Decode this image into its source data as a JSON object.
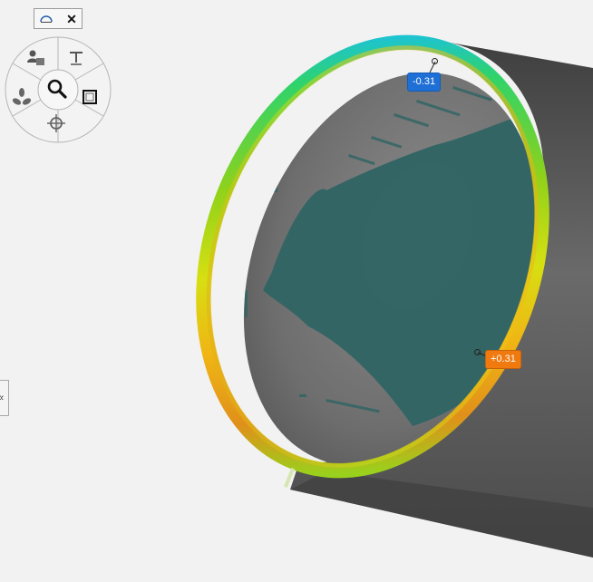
{
  "toolbar": {
    "dome_icon": "dome-icon",
    "close_icon": "close-icon",
    "close_glyph": "✕"
  },
  "radial_menu": {
    "items": [
      {
        "name": "user-view-icon"
      },
      {
        "name": "text-tool-icon"
      },
      {
        "name": "fit-view-icon"
      },
      {
        "name": "target-crosshair-icon"
      },
      {
        "name": "rotate-icon"
      },
      {
        "name": "zoom-search-icon"
      }
    ]
  },
  "side_tab": {
    "glyph": "«"
  },
  "annotations": {
    "negative": {
      "text": "-0.31",
      "color": "#1e6fd6"
    },
    "positive": {
      "text": "+0.31",
      "color": "#f07a10"
    }
  },
  "colors": {
    "background": "#f2f2f2",
    "pipe_outer": "#5a5a5a",
    "pipe_inner": "#7a7a7a",
    "scan_fill": "#2f6464"
  }
}
